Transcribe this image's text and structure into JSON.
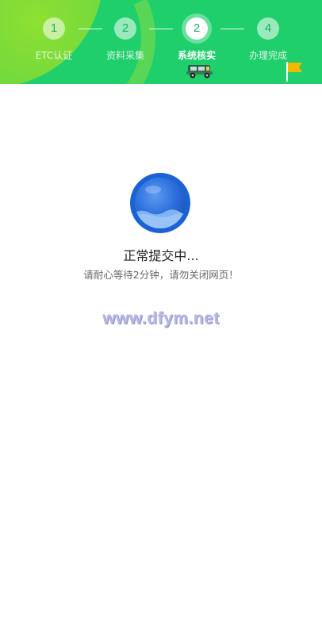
{
  "steps": [
    {
      "number": "1",
      "label": "ETC认证",
      "state": "done"
    },
    {
      "number": "2",
      "label": "资料采集",
      "state": "done"
    },
    {
      "number": "2",
      "label": "系统核实",
      "state": "active"
    },
    {
      "number": "4",
      "label": "办理完成",
      "state": "pending"
    }
  ],
  "status": {
    "title": "正常提交中...",
    "subtitle": "请耐心等待2分钟，请勿关闭网页！"
  },
  "watermark": "www.dfym.net",
  "colors": {
    "header": "#1ecf6b",
    "accent_green": "#1bb062",
    "loader_blue": "#1a62d6",
    "flag": "#f5b800"
  }
}
